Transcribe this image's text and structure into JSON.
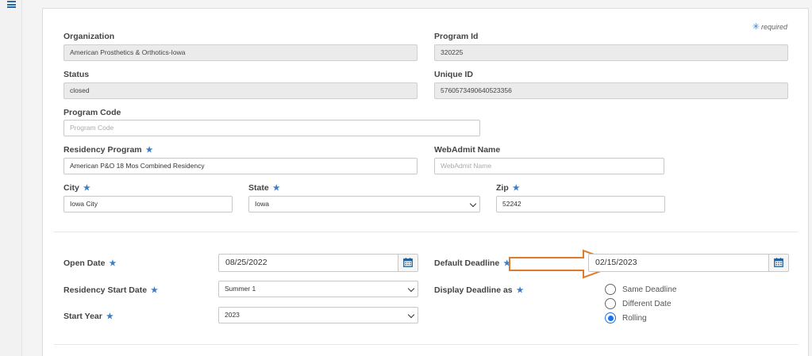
{
  "required_note": "required",
  "required_symbol": "✳",
  "star": "★",
  "fields": {
    "organization": {
      "label": "Organization",
      "value": "American Prosthetics & Orthotics-Iowa"
    },
    "program_id": {
      "label": "Program Id",
      "value": "320225"
    },
    "status": {
      "label": "Status",
      "value": "closed"
    },
    "unique_id": {
      "label": "Unique ID",
      "value": "5760573490640523356"
    },
    "program_code": {
      "label": "Program Code",
      "placeholder": "Program Code"
    },
    "residency_program": {
      "label": "Residency Program",
      "value": "American P&O 18 Mos Combined Residency"
    },
    "webadmit_name": {
      "label": "WebAdmit Name",
      "placeholder": "WebAdmit Name"
    },
    "city": {
      "label": "City",
      "value": "Iowa City"
    },
    "state": {
      "label": "State",
      "value": "Iowa"
    },
    "zip": {
      "label": "Zip",
      "value": "52242"
    },
    "open_date": {
      "label": "Open Date",
      "value": "08/25/2022"
    },
    "default_deadline": {
      "label": "Default Deadline",
      "value": "02/15/2023"
    },
    "residency_start_date": {
      "label": "Residency Start Date",
      "value": "Summer 1"
    },
    "display_deadline_as": {
      "label": "Display Deadline as",
      "options": [
        "Same Deadline",
        "Different Date",
        "Rolling"
      ],
      "selected": "Rolling"
    },
    "start_year": {
      "label": "Start Year",
      "value": "2023"
    }
  },
  "colors": {
    "accent": "#3b7dc4",
    "arrow": "#e07b2a",
    "radio": "#1a73e8"
  }
}
